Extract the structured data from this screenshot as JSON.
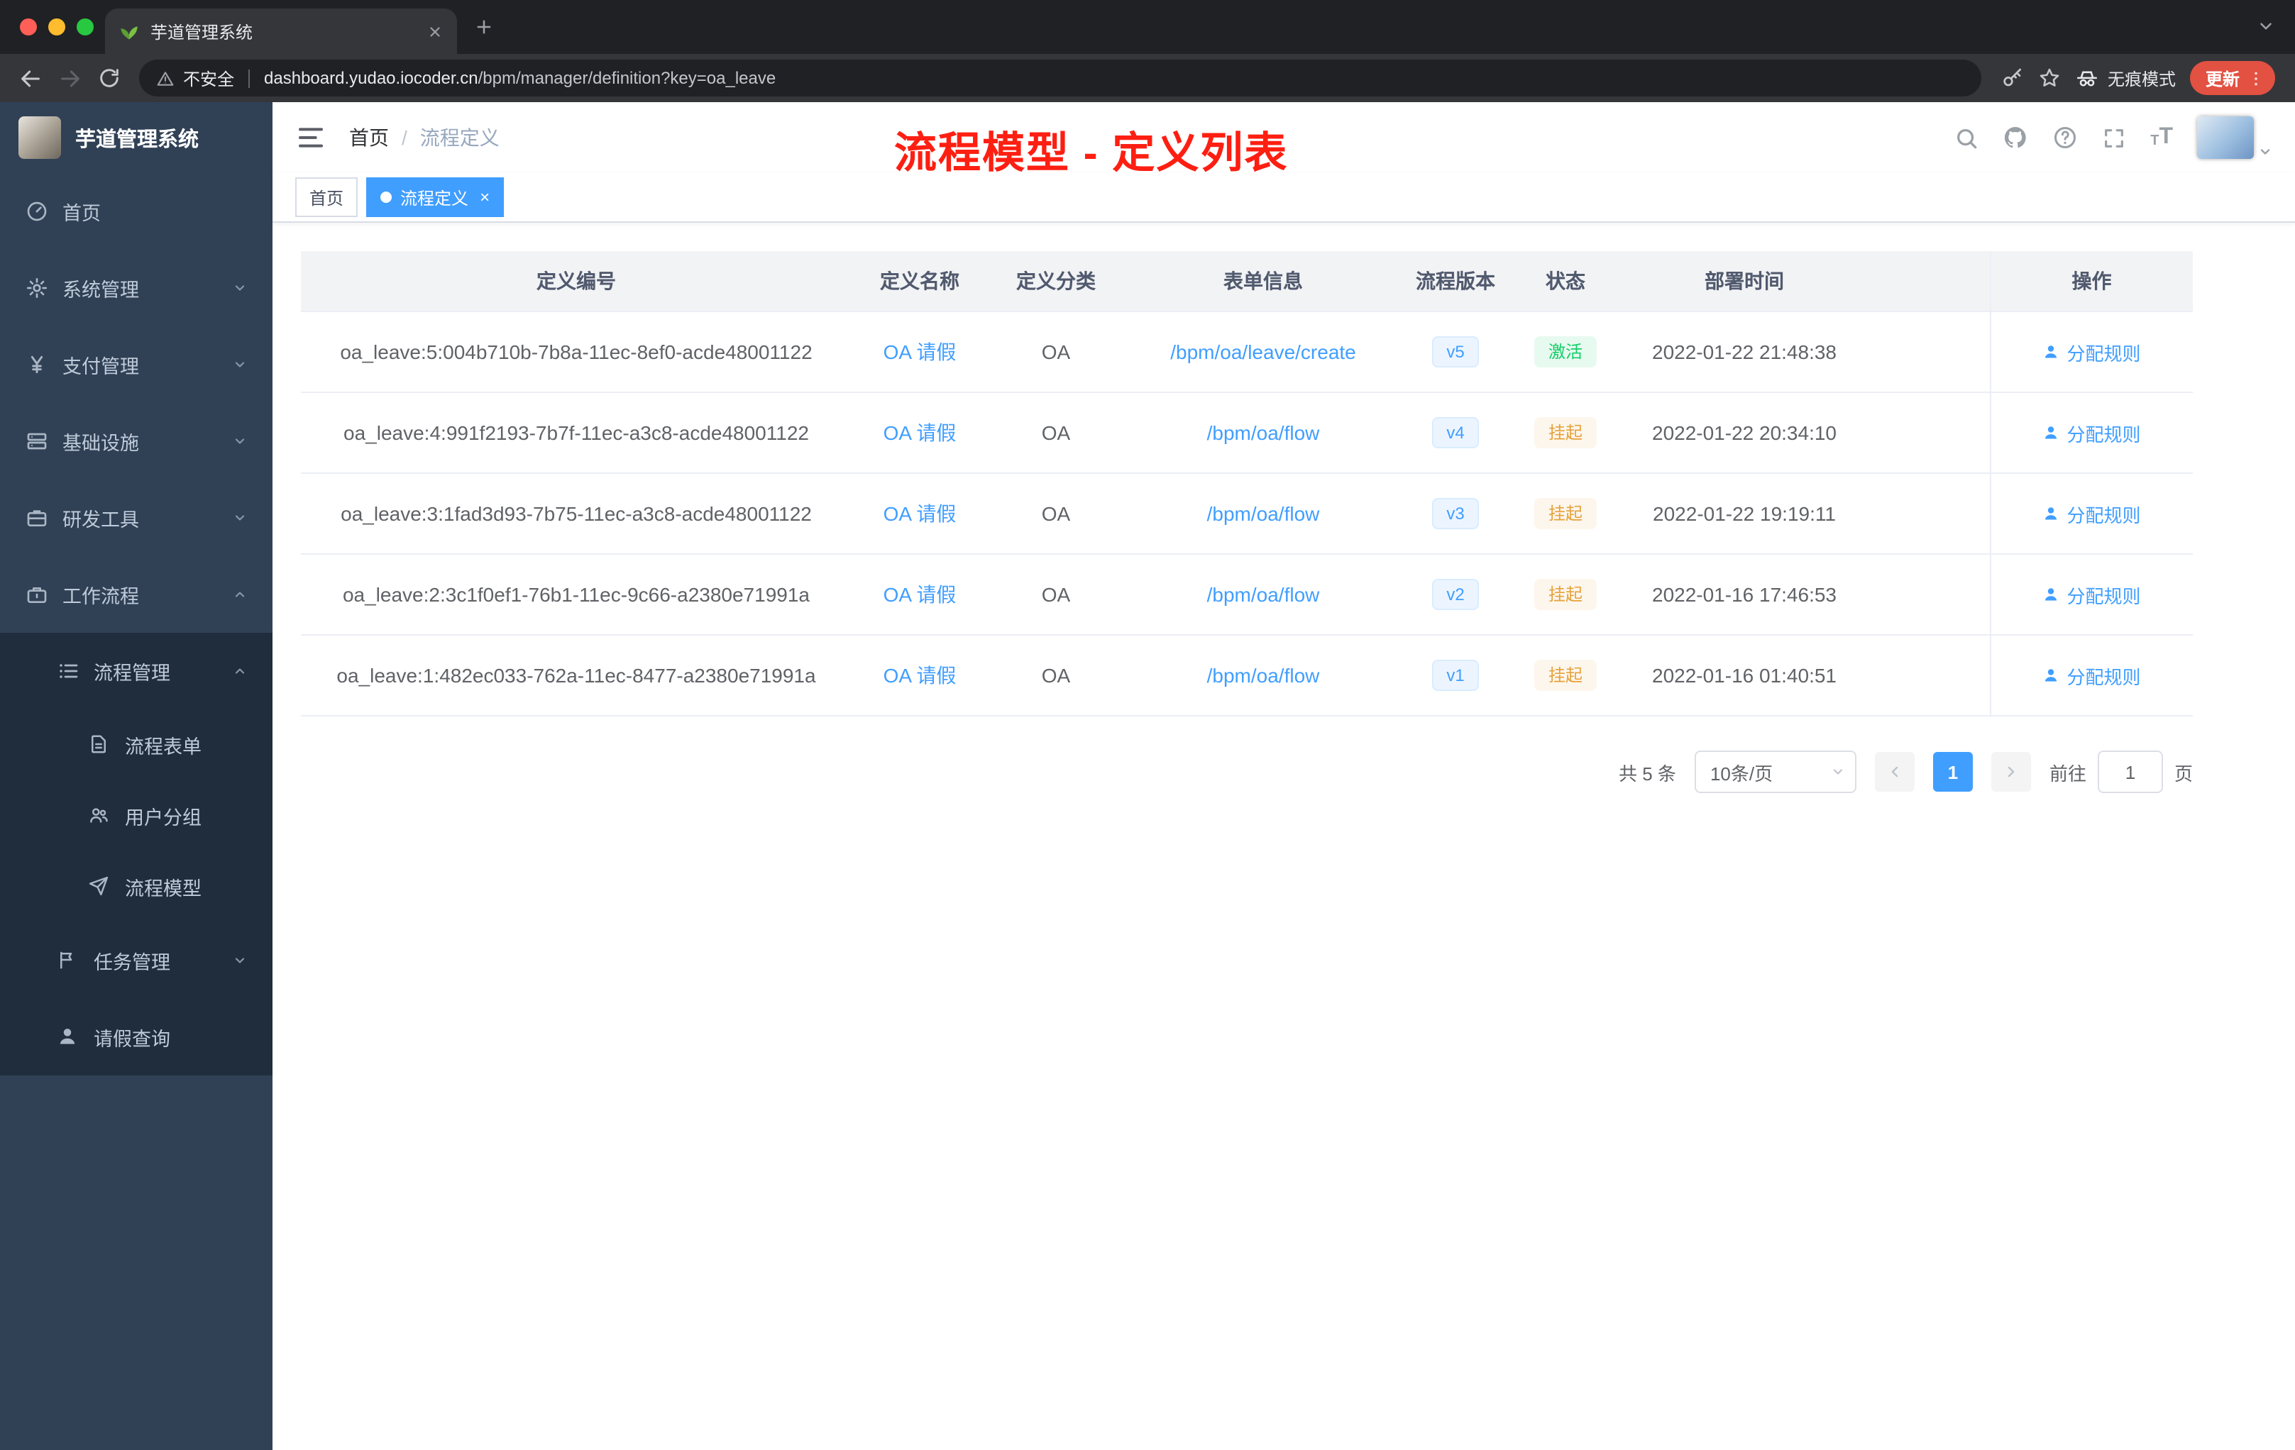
{
  "colors": {
    "accent": "#409eff",
    "success": "#13ce66",
    "warning": "#e6a23c",
    "annotation_red": "#fd1f12",
    "sidebar_bg": "#304156",
    "sidebar_sub_bg": "#1f2d3d",
    "version_badge_bg": "#ecf5ff",
    "status_success_bg": "#e7faf0",
    "status_warning_bg": "#fdf6ec"
  },
  "browser": {
    "tab_title": "芋道管理系统",
    "not_secure_label": "不安全",
    "url_host": "dashboard.yudao.iocoder.cn",
    "url_path": "/bpm/manager/definition?key=oa_leave",
    "incognito_label": "无痕模式",
    "update_label": "更新"
  },
  "icons": {
    "browser": [
      "back-icon",
      "forward-icon",
      "reload-icon",
      "warning-icon",
      "key-icon",
      "star-icon",
      "incognito-icon",
      "more-vert-icon",
      "tab-favicon-leaf",
      "close-icon",
      "plus-icon",
      "chevron-down-icon"
    ],
    "header": [
      "hamburger-icon",
      "search-icon",
      "github-icon",
      "help-icon",
      "fullscreen-icon",
      "font-size-icon",
      "caret-down-icon"
    ],
    "table": [
      "user-icon"
    ]
  },
  "sidebar": {
    "app_title": "芋道管理系统",
    "items": [
      {
        "label": "首页",
        "icon": "dashboard-icon"
      },
      {
        "label": "系统管理",
        "icon": "gear-icon",
        "chevron": "down"
      },
      {
        "label": "支付管理",
        "icon": "yen-icon",
        "chevron": "down"
      },
      {
        "label": "基础设施",
        "icon": "server-icon",
        "chevron": "down"
      },
      {
        "label": "研发工具",
        "icon": "toolbox-icon",
        "chevron": "down"
      },
      {
        "label": "工作流程",
        "icon": "briefcase-icon",
        "chevron": "up"
      },
      {
        "label": "流程管理",
        "icon": "list-icon",
        "chevron": "up"
      },
      {
        "label": "流程表单",
        "icon": "document-icon"
      },
      {
        "label": "用户分组",
        "icon": "users-icon"
      },
      {
        "label": "流程模型",
        "icon": "send-icon"
      },
      {
        "label": "任务管理",
        "icon": "flag-icon",
        "chevron": "down"
      },
      {
        "label": "请假查询",
        "icon": "user-icon"
      }
    ]
  },
  "header": {
    "breadcrumb": {
      "home": "首页",
      "separator": "/",
      "current": "流程定义"
    },
    "annotation": "流程模型 - 定义列表"
  },
  "tags": {
    "items": [
      {
        "label": "首页",
        "active": false
      },
      {
        "label": "流程定义",
        "active": true
      }
    ]
  },
  "table": {
    "columns": {
      "id": "定义编号",
      "name": "定义名称",
      "category": "定义分类",
      "form": "表单信息",
      "version": "流程版本",
      "status": "状态",
      "deploy_time": "部署时间",
      "actions": "操作"
    },
    "rows": [
      {
        "id": "oa_leave:5:004b710b-7b8a-11ec-8ef0-acde48001122",
        "name": "OA 请假",
        "category": "OA",
        "form": "/bpm/oa/leave/create",
        "version": "v5",
        "status": "激活",
        "deploy_time": "2022-01-22 21:48:38",
        "action": "分配规则"
      },
      {
        "id": "oa_leave:4:991f2193-7b7f-11ec-a3c8-acde48001122",
        "name": "OA 请假",
        "category": "OA",
        "form": "/bpm/oa/flow",
        "version": "v4",
        "status": "挂起",
        "deploy_time": "2022-01-22 20:34:10",
        "action": "分配规则"
      },
      {
        "id": "oa_leave:3:1fad3d93-7b75-11ec-a3c8-acde48001122",
        "name": "OA 请假",
        "category": "OA",
        "form": "/bpm/oa/flow",
        "version": "v3",
        "status": "挂起",
        "deploy_time": "2022-01-22 19:19:11",
        "action": "分配规则"
      },
      {
        "id": "oa_leave:2:3c1f0ef1-76b1-11ec-9c66-a2380e71991a",
        "name": "OA 请假",
        "category": "OA",
        "form": "/bpm/oa/flow",
        "version": "v2",
        "status": "挂起",
        "deploy_time": "2022-01-16 17:46:53",
        "action": "分配规则"
      },
      {
        "id": "oa_leave:1:482ec033-762a-11ec-8477-a2380e71991a",
        "name": "OA 请假",
        "category": "OA",
        "form": "/bpm/oa/flow",
        "version": "v1",
        "status": "挂起",
        "deploy_time": "2022-01-16 01:40:51",
        "action": "分配规则"
      }
    ]
  },
  "pagination": {
    "total": "共 5 条",
    "page_size": "10条/页",
    "current_page": "1",
    "goto_label": "前往",
    "goto_value": "1",
    "page_unit": "页"
  }
}
